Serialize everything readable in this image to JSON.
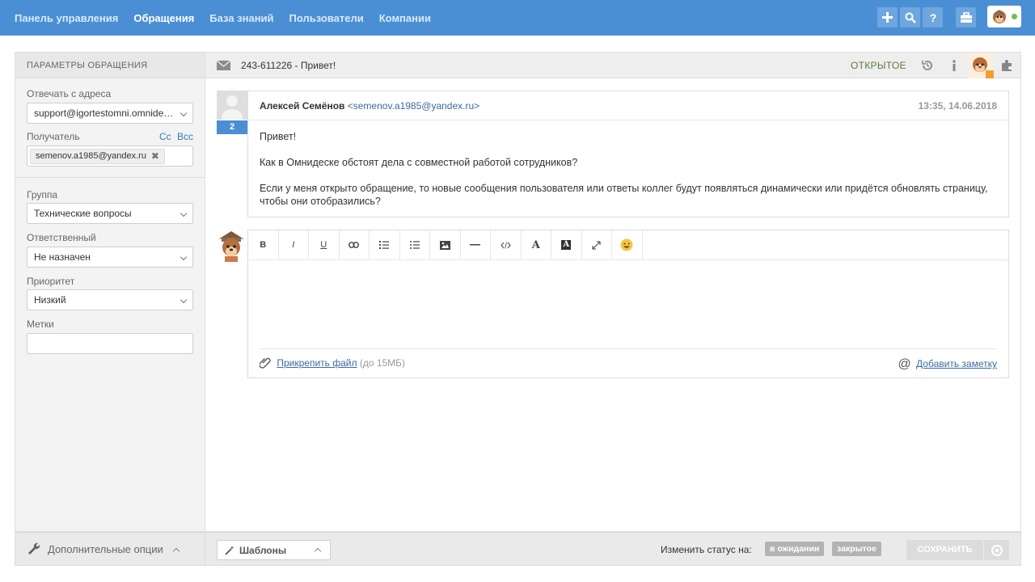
{
  "nav": {
    "items": [
      "Панель управления",
      "Обращения",
      "База знаний",
      "Пользователи",
      "Компании"
    ],
    "active": "Обращения"
  },
  "toolbar_icons": [
    "plus-icon",
    "search-icon",
    "question-icon",
    "briefcase-icon"
  ],
  "user": {
    "online_color": "#6cc04a"
  },
  "left_panel": {
    "title": "ПАРАМЕТРЫ ОБРАЩЕНИЯ",
    "reply_from_label": "Отвечать с адреса",
    "reply_from_value": "support@igortestomni.omnidesk.ru",
    "recipient_label": "Получатель",
    "cc_label": "Cc",
    "bcc_label": "Bcc",
    "recipient_tag": "semenov.a1985@yandex.ru",
    "group_label": "Группа",
    "group_value": "Технические вопросы",
    "assignee_label": "Ответственный",
    "assignee_value": "Не назначен",
    "priority_label": "Приоритет",
    "priority_value": "Низкий",
    "tags_label": "Метки",
    "tags_value": ""
  },
  "ticket": {
    "subject": "243-611226 - Привет!",
    "status": "ОТКРЫТОЕ"
  },
  "message": {
    "count": "2",
    "author": "Алексей Семёнов",
    "email": "<semenov.a1985@yandex.ru>",
    "time": "13:35, 14.06.2018",
    "paragraphs": [
      "Привет!",
      "Как в Омнидеске обстоят дела с совместной работой сотрудников?",
      "Если у меня открыто обращение, то новые сообщения пользователя или ответы коллег будут появляться динамически или придётся обновлять страницу, чтобы они отобразились?"
    ]
  },
  "editor": {
    "tools": {
      "bold": "B",
      "italic": "I",
      "underline": "U",
      "font": "A",
      "bg": "A"
    },
    "attach_link": "Прикрепить файл",
    "attach_limit": "(до 15МБ)",
    "note_link": "Добавить заметку"
  },
  "footer": {
    "more_options": "Дополнительные опции",
    "templates": "Шаблоны",
    "change_status": "Изменить статус на:",
    "status_pending": "в ожидании",
    "status_closed": "закрытое",
    "save": "СОХРАНИТЬ"
  },
  "colors": {
    "topbar": "#4a8fd4",
    "status_open": "#5b7a3c",
    "link": "#3a6aa0"
  }
}
